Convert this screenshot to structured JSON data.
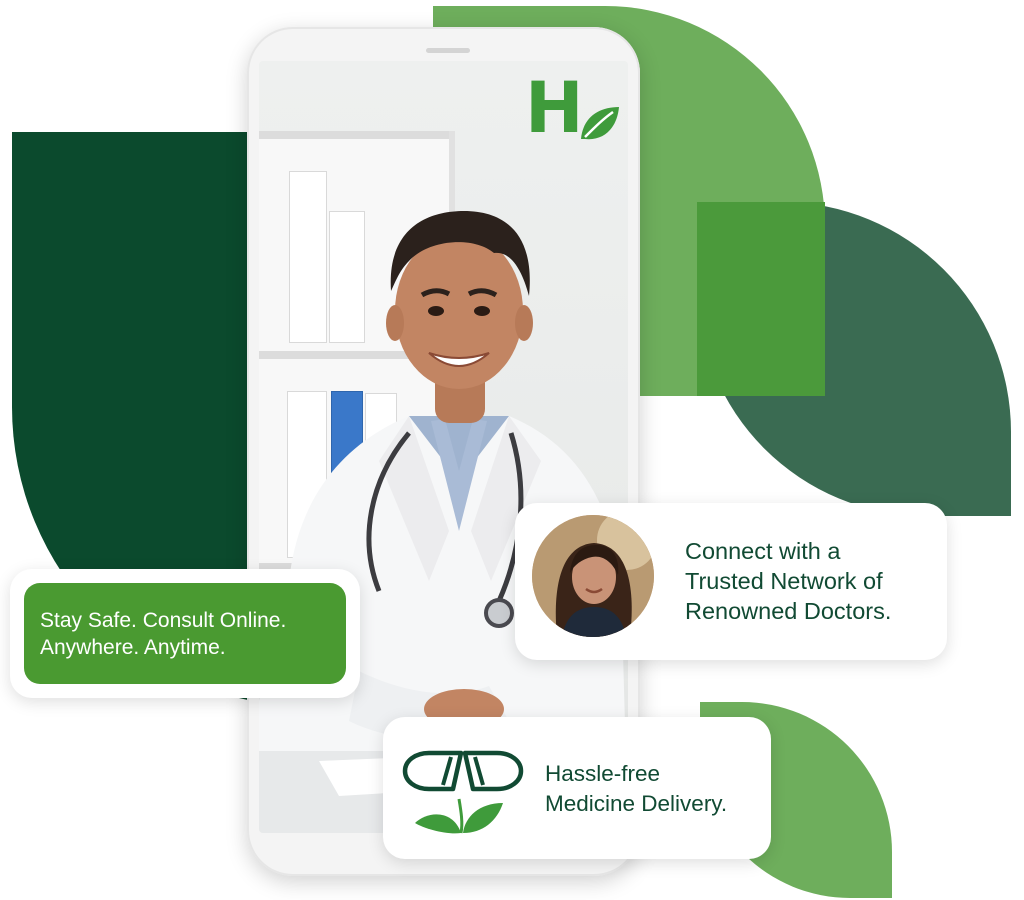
{
  "colors": {
    "dark_green": "#0b4a2d",
    "light_green": "#6eae5c",
    "muted_green": "#3a6b52",
    "brand_green": "#4a9a31",
    "logo_green": "#3f9b3b",
    "text_green": "#114a33"
  },
  "logo": {
    "letter": "H",
    "icon": "leaf-icon"
  },
  "cards": {
    "consult": {
      "text": "Stay Safe. Consult Online.\nAnywhere. Anytime."
    },
    "network": {
      "text": "Connect with a\nTrusted Network of\nRenowned Doctors.",
      "avatar_icon": "patient-avatar"
    },
    "delivery": {
      "text": "Hassle-free\nMedicine Delivery.",
      "icon": "capsule-leaf-icon"
    }
  }
}
